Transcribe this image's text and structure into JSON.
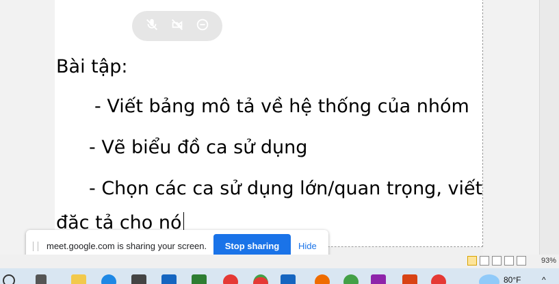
{
  "document": {
    "lines": [
      "Bài tập:",
      "- Viết bảng mô tả về hệ thống của nhóm",
      "- Vẽ biểu đồ ca sử dụng",
      "- Chọn các ca sử dụng lớn/quan trọng, viết",
      "đặc tả cho nó"
    ]
  },
  "meet_controls": {
    "icons": [
      "mic-off-icon",
      "camera-off-icon",
      "minimize-icon"
    ]
  },
  "share_bar": {
    "message": "meet.google.com is sharing your screen.",
    "stop_label": "Stop sharing",
    "hide_label": "Hide"
  },
  "status_bar": {
    "zoom": "93%"
  },
  "taskbar": {
    "weather_text": "80°F"
  },
  "colors": {
    "accent": "#1a73e8",
    "doc_background": "#ffffff",
    "taskbar": "#d9e6f2"
  }
}
